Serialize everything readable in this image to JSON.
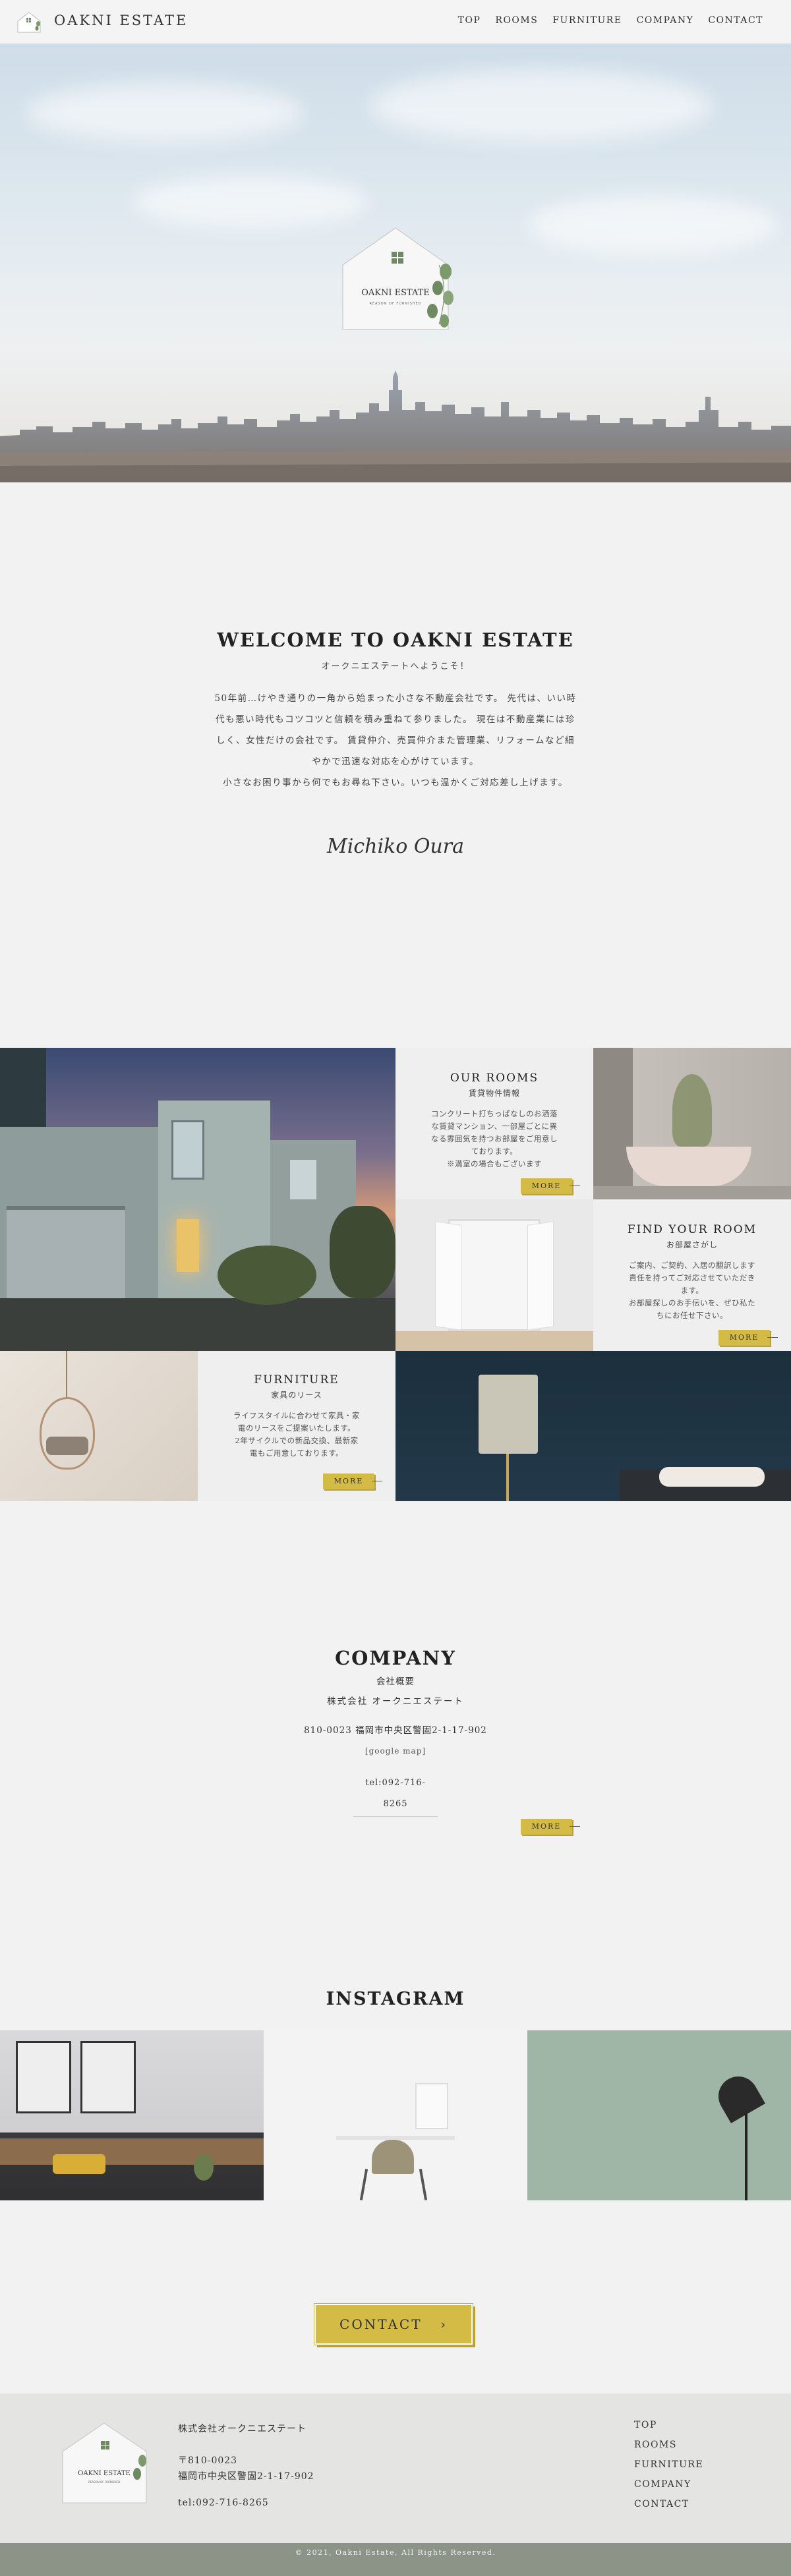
{
  "brand": {
    "name": "OAKNI ESTATE",
    "logo_word": "OAKNI ESTATE",
    "logo_tag": "REASON OF FURNISHED"
  },
  "nav": {
    "items": [
      "TOP",
      "ROOMS",
      "FURNITURE",
      "COMPANY",
      "CONTACT"
    ]
  },
  "welcome": {
    "title": "WELCOME TO OAKNI ESTATE",
    "subtitle": "オークニエステートへようこそ！",
    "lines": [
      "50年前…けやき通りの一角から始まった小さな不動産会社です。 先代は、いい時",
      "代も悪い時代もコツコツと信頼を積み重ねて参りました。 現在は不動産業には珍",
      "しく、女性だけの会社です。 賃貸仲介、売買仲介また管理業、リフォームなど細",
      "やかで迅速な対応を心がけています。",
      "小さなお困り事から何でもお尋ね下さい。いつも温かくご対応差し上げます。"
    ],
    "signature": "Michiko Oura"
  },
  "cards": {
    "rooms": {
      "title": "OUR ROOMS",
      "subtitle": "賃貸物件情報",
      "body": [
        "コンクリート打ちっぱなしのお洒落",
        "な賃貸マンション、一部屋ごとに異",
        "なる雰囲気を持つお部屋をご用意し",
        "ております。",
        "※満室の場合もございます"
      ],
      "more": "MORE"
    },
    "find": {
      "title": "FIND YOUR ROOM",
      "subtitle": "お部屋さがし",
      "body": [
        "ご案内、ご契約、入居の翻訳します",
        "責任を持ってご対応させていただき",
        "ます。",
        "お部屋探しのお手伝いを、ぜひ私た",
        "ちにお任せ下さい。"
      ],
      "more": "MORE"
    },
    "furniture": {
      "title": "FURNITURE",
      "subtitle": "家具のリース",
      "body": [
        "ライフスタイルに合わせて家具・家",
        "電のリースをご提案いたします。",
        "2年サイクルでの新品交換、最新家",
        "電もご用意しております。"
      ],
      "more": "MORE"
    }
  },
  "company": {
    "title": "COMPANY",
    "subtitle": "会社概要",
    "name": "株式会社 オークニエステート",
    "address": "810-0023 福岡市中央区警固2-1-17-902",
    "map_link": "[google map]",
    "tel_lines": [
      "tel:092-716-",
      "8265"
    ],
    "more": "MORE"
  },
  "instagram": {
    "title": "INSTAGRAM"
  },
  "contact": {
    "label": "CONTACT",
    "arrow": "›"
  },
  "footer": {
    "company": "株式会社オークニエステート",
    "postal": "〒810-0023",
    "address": "福岡市中央区警固2-1-17-902",
    "tel": "tel:092-716-8265",
    "nav": [
      "TOP",
      "ROOMS",
      "FURNITURE",
      "COMPANY",
      "CONTACT"
    ],
    "copyright": "© 2021, Oakni Estate, All Rights Reserved."
  },
  "colors": {
    "accent": "#d4bb46",
    "footer_bar": "#8c9488",
    "leaf": "#6f8a62",
    "navy_wall": "#1f3340"
  }
}
